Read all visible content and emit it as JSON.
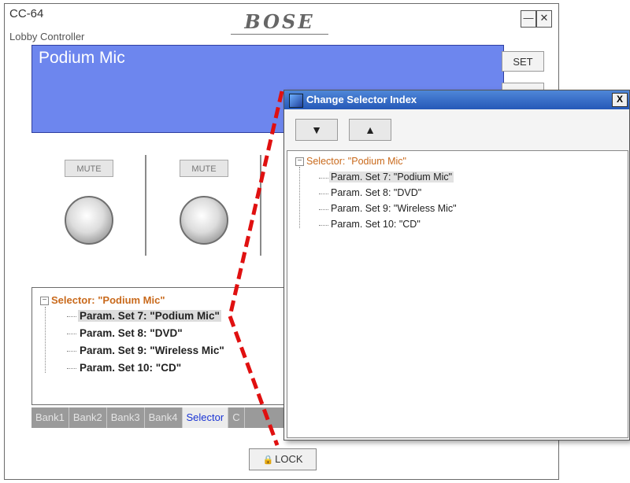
{
  "window": {
    "model": "CC-64",
    "subtitle": "Lobby Controller",
    "logo": "BOSE",
    "minimize": "—",
    "close": "✕"
  },
  "display": {
    "text": "Podium Mic",
    "color": "#6d86ee"
  },
  "side_buttons": {
    "set": "SET"
  },
  "channels": [
    {
      "mute": "MUTE"
    },
    {
      "mute": "MUTE"
    }
  ],
  "tree": {
    "root": "Selector: \"Podium Mic\"",
    "items": [
      "Param. Set 7: \"Podium Mic\"",
      "Param. Set 8: \"DVD\"",
      "Param. Set 9: \"Wireless Mic\"",
      "Param. Set 10: \"CD\""
    ],
    "selected_index": 0
  },
  "tabs": [
    {
      "label": "Bank1"
    },
    {
      "label": "Bank2"
    },
    {
      "label": "Bank3"
    },
    {
      "label": "Bank4"
    },
    {
      "label": "Selector"
    },
    {
      "label": "C"
    }
  ],
  "lock": {
    "label": "LOCK",
    "icon": "lock-icon"
  },
  "dialog": {
    "title": "Change Selector Index",
    "close": "X",
    "down": "▼",
    "up": "▲",
    "root": "Selector: \"Podium Mic\"",
    "items": [
      "Param. Set 7: \"Podium Mic\"",
      "Param. Set 8: \"DVD\"",
      "Param. Set 9: \"Wireless Mic\"",
      "Param. Set 10: \"CD\""
    ]
  },
  "colors": {
    "accent_line": "#e01010",
    "title_bar": "#2a5fbf",
    "selector_text": "#c96a1c",
    "active_tab_text": "#1a34d4"
  }
}
